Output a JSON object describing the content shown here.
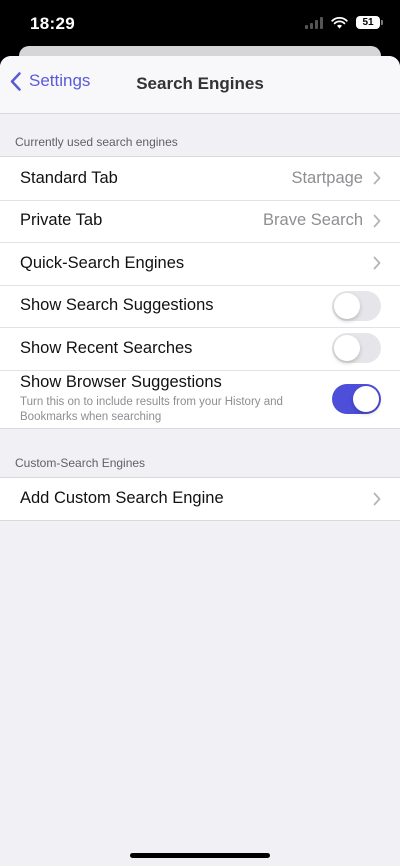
{
  "status": {
    "time": "18:29",
    "battery": "51"
  },
  "nav": {
    "back_label": "Settings",
    "title": "Search Engines"
  },
  "section1": {
    "header": "Currently used search engines",
    "rows": [
      {
        "label": "Standard Tab",
        "value": "Startpage"
      },
      {
        "label": "Private Tab",
        "value": "Brave Search"
      },
      {
        "label": "Quick-Search Engines"
      }
    ],
    "toggles": [
      {
        "label": "Show Search Suggestions",
        "on": false
      },
      {
        "label": "Show Recent Searches",
        "on": false
      },
      {
        "label": "Show Browser Suggestions",
        "subtitle": "Turn this on to include results from your History and Bookmarks when searching",
        "on": true
      }
    ]
  },
  "section2": {
    "header": "Custom-Search Engines",
    "rows": [
      {
        "label": "Add Custom Search Engine"
      }
    ]
  },
  "colors": {
    "accent": "#5a5bd6",
    "toggle_on": "#4d4ed9",
    "background": "#f1f1f5"
  }
}
